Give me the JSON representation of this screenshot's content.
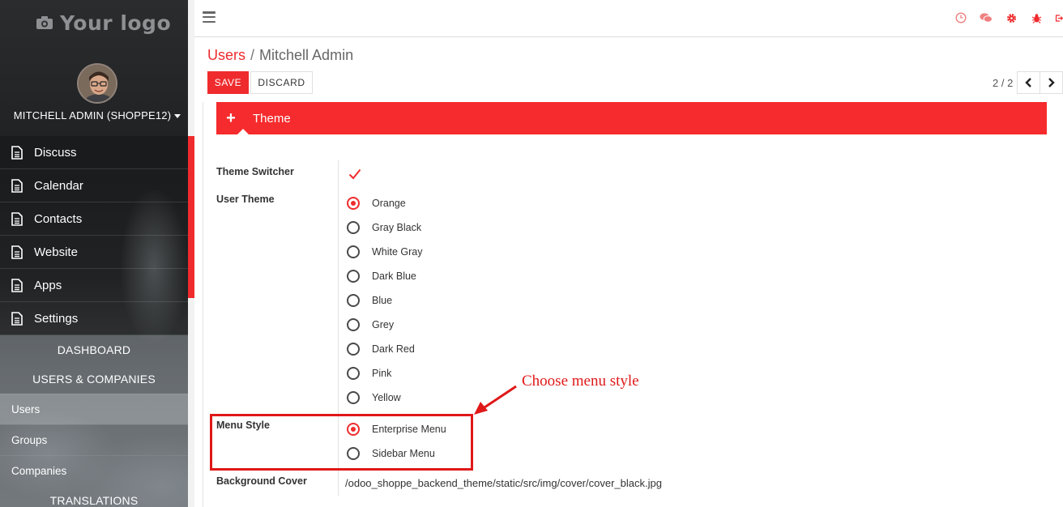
{
  "brand": {
    "logo_text": "Your logo",
    "accent": "#ef2b2d"
  },
  "user": {
    "name": "MITCHELL ADMIN (SHOPPE12)"
  },
  "sidebar": {
    "items": [
      {
        "label": "Discuss"
      },
      {
        "label": "Calendar"
      },
      {
        "label": "Contacts"
      },
      {
        "label": "Website"
      },
      {
        "label": "Apps"
      },
      {
        "label": "Settings"
      }
    ],
    "submenu": {
      "dashboard": "DASHBOARD",
      "users_companies": "USERS & COMPANIES",
      "links": [
        {
          "label": "Users"
        },
        {
          "label": "Groups"
        },
        {
          "label": "Companies"
        }
      ],
      "translations": "TRANSLATIONS"
    }
  },
  "topbar": {
    "icons": [
      "clock-icon",
      "chat-icon",
      "gear-icon",
      "bug-icon",
      "logout-icon"
    ]
  },
  "breadcrumb": {
    "parent": "Users",
    "separator": "/",
    "current": "Mitchell Admin"
  },
  "buttons": {
    "save": "SAVE",
    "discard": "DISCARD"
  },
  "pager": {
    "value": "2 / 2"
  },
  "form": {
    "tab_label": "Theme",
    "theme_switcher_label": "Theme Switcher",
    "theme_switcher_checked": true,
    "user_theme_label": "User Theme",
    "user_theme_options": [
      {
        "label": "Orange",
        "selected": true
      },
      {
        "label": "Gray Black",
        "selected": false
      },
      {
        "label": "White Gray",
        "selected": false
      },
      {
        "label": "Dark Blue",
        "selected": false
      },
      {
        "label": "Blue",
        "selected": false
      },
      {
        "label": "Grey",
        "selected": false
      },
      {
        "label": "Dark Red",
        "selected": false
      },
      {
        "label": "Pink",
        "selected": false
      },
      {
        "label": "Yellow",
        "selected": false
      }
    ],
    "menu_style_label": "Menu Style",
    "menu_style_options": [
      {
        "label": "Enterprise Menu",
        "selected": true
      },
      {
        "label": "Sidebar Menu",
        "selected": false
      }
    ],
    "background_cover_label": "Background Cover",
    "background_cover_value": "/odoo_shoppe_backend_theme/static/src/img/cover/cover_black.jpg"
  },
  "annotation": {
    "text": "Choose menu style",
    "color": "#e01818"
  }
}
